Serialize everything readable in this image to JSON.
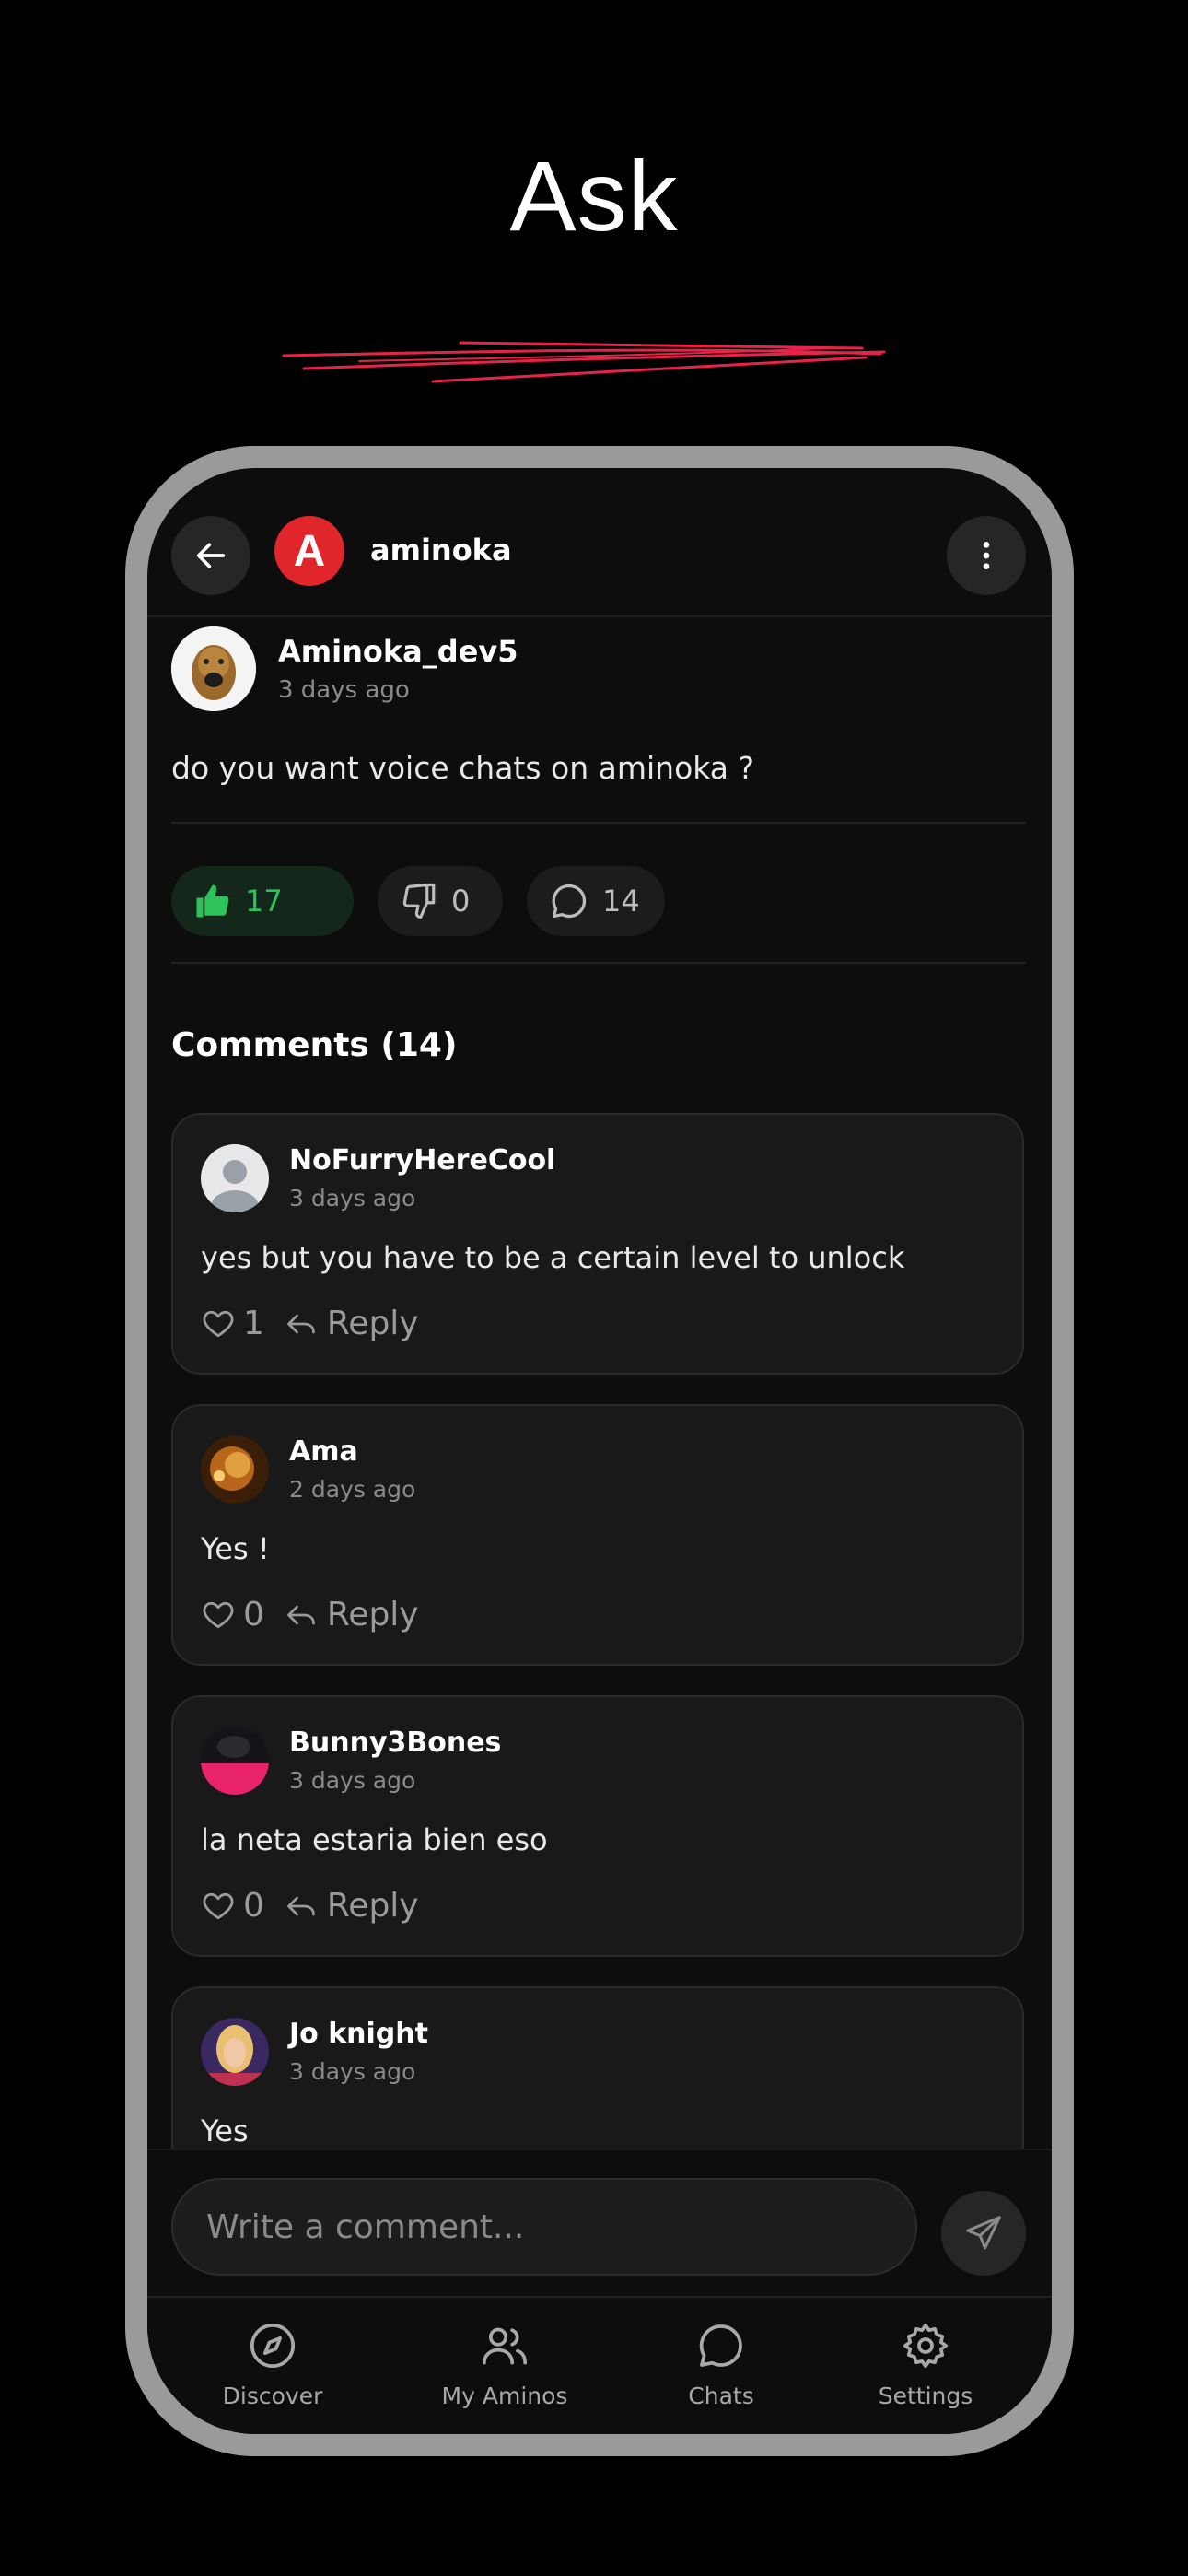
{
  "hero": {
    "title": "Ask"
  },
  "header": {
    "community_name": "aminoka",
    "logo_letter": "A"
  },
  "post": {
    "author": "Aminoka_dev5",
    "time": "3 days ago",
    "body": "do you want voice chats on aminoka ?",
    "likes": "17",
    "dislikes": "0",
    "comments": "14"
  },
  "comments_title": "Comments (14)",
  "comments": [
    {
      "author": "NoFurryHereCool",
      "time": "3 days ago",
      "text": "yes but you have to be a certain level to unlock",
      "likes": "1",
      "reply": "Reply"
    },
    {
      "author": "Ama",
      "time": "2 days ago",
      "text": "Yes !",
      "likes": "0",
      "reply": "Reply"
    },
    {
      "author": "Bunny3Bones",
      "time": "3 days ago",
      "text": "la neta estaria bien eso",
      "likes": "0",
      "reply": "Reply"
    },
    {
      "author": "Jo knight",
      "time": "3 days ago",
      "text": "Yes",
      "likes": "",
      "reply": ""
    }
  ],
  "compose": {
    "placeholder": "Write a comment..."
  },
  "tabs": [
    {
      "label": "Discover",
      "icon": "compass-icon"
    },
    {
      "label": "My Aminos",
      "icon": "users-icon"
    },
    {
      "label": "Chats",
      "icon": "chat-bubble-icon"
    },
    {
      "label": "Settings",
      "icon": "gear-icon"
    }
  ],
  "colors": {
    "accent_red": "#e0262a",
    "like_green": "#2ec25d",
    "scribble": "#e8234a"
  }
}
